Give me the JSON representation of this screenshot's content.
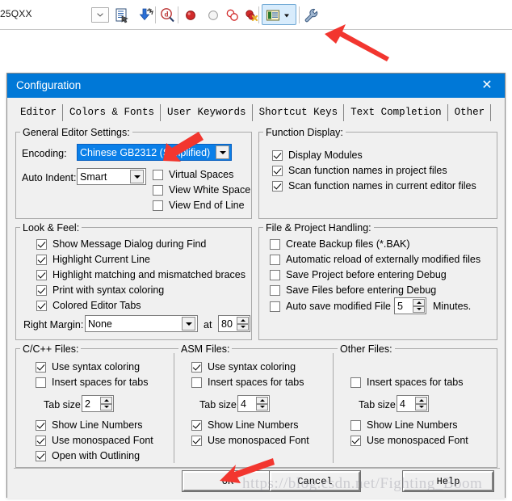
{
  "toolbar": {
    "file_text": "25QXX",
    "combo_icon": "chevron-down-icon",
    "icons": [
      {
        "name": "document-refresh-icon"
      },
      {
        "name": "download-blue-arrow-icon"
      },
      {
        "name": "find-in-files-icon"
      },
      {
        "name": "breakpoint-insert-icon"
      },
      {
        "name": "breakpoint-disable-icon"
      },
      {
        "name": "breakpoint-kill-all-icon"
      },
      {
        "name": "breakpoint-remove-icon"
      },
      {
        "name": "configuration-target-options-icon"
      },
      {
        "name": "configuration-wizard-wrench-icon"
      }
    ]
  },
  "dialog": {
    "title": "Configuration",
    "close_label": "✕",
    "tabs": [
      {
        "label": "Editor",
        "selected": true
      },
      {
        "label": "Colors & Fonts",
        "selected": false
      },
      {
        "label": "User Keywords",
        "selected": false
      },
      {
        "label": "Shortcut Keys",
        "selected": false
      },
      {
        "label": "Text Completion",
        "selected": false
      },
      {
        "label": "Other",
        "selected": false
      }
    ],
    "general_editor": {
      "legend": "General Editor Settings:",
      "encoding_label": "Encoding:",
      "encoding_value": "Chinese GB2312 (Simplified)",
      "auto_indent_label": "Auto Indent:",
      "auto_indent_value": "Smart",
      "checks": [
        {
          "label": "Virtual Spaces",
          "checked": false
        },
        {
          "label": "View White Space",
          "checked": false
        },
        {
          "label": "View End of Line",
          "checked": false
        }
      ]
    },
    "function_display": {
      "legend": "Function Display:",
      "checks": [
        {
          "label": "Display Modules",
          "checked": true
        },
        {
          "label": "Scan function names in project files",
          "checked": true
        },
        {
          "label": "Scan function names in current editor files",
          "checked": true
        }
      ]
    },
    "look_feel": {
      "legend": "Look & Feel:",
      "checks": [
        {
          "label": "Show Message Dialog during Find",
          "checked": true
        },
        {
          "label": "Highlight Current Line",
          "checked": true
        },
        {
          "label": "Highlight matching and mismatched braces",
          "checked": true
        },
        {
          "label": "Print with syntax coloring",
          "checked": true
        },
        {
          "label": "Colored Editor Tabs",
          "checked": true
        }
      ],
      "right_margin_label": "Right Margin:",
      "right_margin_value": "None",
      "at_label": "at",
      "at_value": "80"
    },
    "file_project": {
      "legend": "File & Project Handling:",
      "checks": [
        {
          "label": "Create Backup files (*.BAK)",
          "checked": false
        },
        {
          "label": "Automatic reload of externally modified files",
          "checked": false
        },
        {
          "label": "Save Project before entering Debug",
          "checked": false
        },
        {
          "label": "Save Files before entering Debug",
          "checked": false
        },
        {
          "label": "Auto save modified File every",
          "checked": false
        }
      ],
      "autosave_value": "5",
      "minutes_label": "Minutes."
    },
    "c_files": {
      "legend": "C/C++ Files:",
      "checks_top": [
        {
          "label": "Use syntax coloring",
          "checked": true
        },
        {
          "label": "Insert spaces for tabs",
          "checked": false
        }
      ],
      "tab_size_label": "Tab size:",
      "tab_size_value": "2",
      "checks_bottom": [
        {
          "label": "Show Line Numbers",
          "checked": true
        },
        {
          "label": "Use monospaced Font",
          "checked": true
        },
        {
          "label": "Open with Outlining",
          "checked": true
        }
      ]
    },
    "asm_files": {
      "legend": "ASM Files:",
      "checks_top": [
        {
          "label": "Use syntax coloring",
          "checked": true
        },
        {
          "label": "Insert spaces for tabs",
          "checked": false
        }
      ],
      "tab_size_label": "Tab size:",
      "tab_size_value": "4",
      "checks_bottom": [
        {
          "label": "Show Line Numbers",
          "checked": true
        },
        {
          "label": "Use monospaced Font",
          "checked": true
        }
      ]
    },
    "other_files": {
      "legend": "Other Files:",
      "checks_top": [
        {
          "label": "Insert spaces for tabs",
          "checked": false
        }
      ],
      "tab_size_label": "Tab size:",
      "tab_size_value": "4",
      "checks_bottom": [
        {
          "label": "Show Line Numbers",
          "checked": false
        },
        {
          "label": "Use monospaced Font",
          "checked": true
        }
      ]
    },
    "buttons": {
      "ok": "OK",
      "cancel": "Cancel",
      "help": "Help"
    }
  },
  "watermark": "https://blog.csdn.net/Fighting_Boom",
  "colors": {
    "titlebar": "#0078d7",
    "dialog_bg": "#f0f0f0",
    "selection_blue": "#0a7fe8",
    "annotation_red": "#f2362f"
  }
}
